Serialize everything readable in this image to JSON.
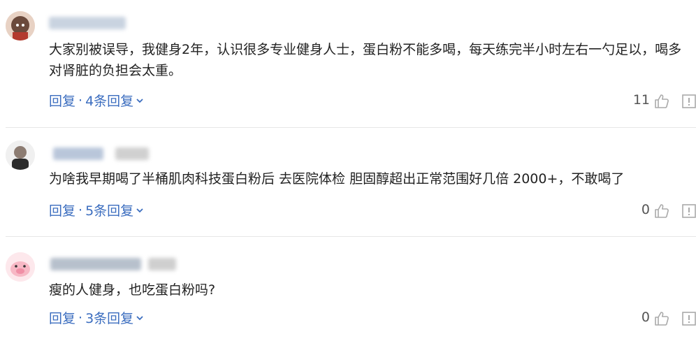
{
  "comments": [
    {
      "text": "大家别被误导，我健身2年，认识很多专业健身人士，蛋白粉不能多喝，每天练完半小时左右一勺足以，喝多对肾脏的负担会太重。",
      "reply_label": "回复",
      "separator": "·",
      "replies_label": "4条回复",
      "likes": "11"
    },
    {
      "text": "为啥我早期喝了半桶肌肉科技蛋白粉后 去医院体检 胆固醇超出正常范围好几倍 2000+，不敢喝了",
      "reply_label": "回复",
      "separator": "·",
      "replies_label": "5条回复",
      "likes": "0"
    },
    {
      "text": "瘦的人健身，也吃蛋白粉吗?",
      "reply_label": "回复",
      "separator": "·",
      "replies_label": "3条回复",
      "likes": "0"
    }
  ],
  "icons": {
    "like": "thumbs-up-icon",
    "report": "report-icon",
    "expand": "chevron-down-icon"
  },
  "colors": {
    "link": "#3b6dbf",
    "text": "#222222",
    "icon": "#bbbbbb"
  }
}
